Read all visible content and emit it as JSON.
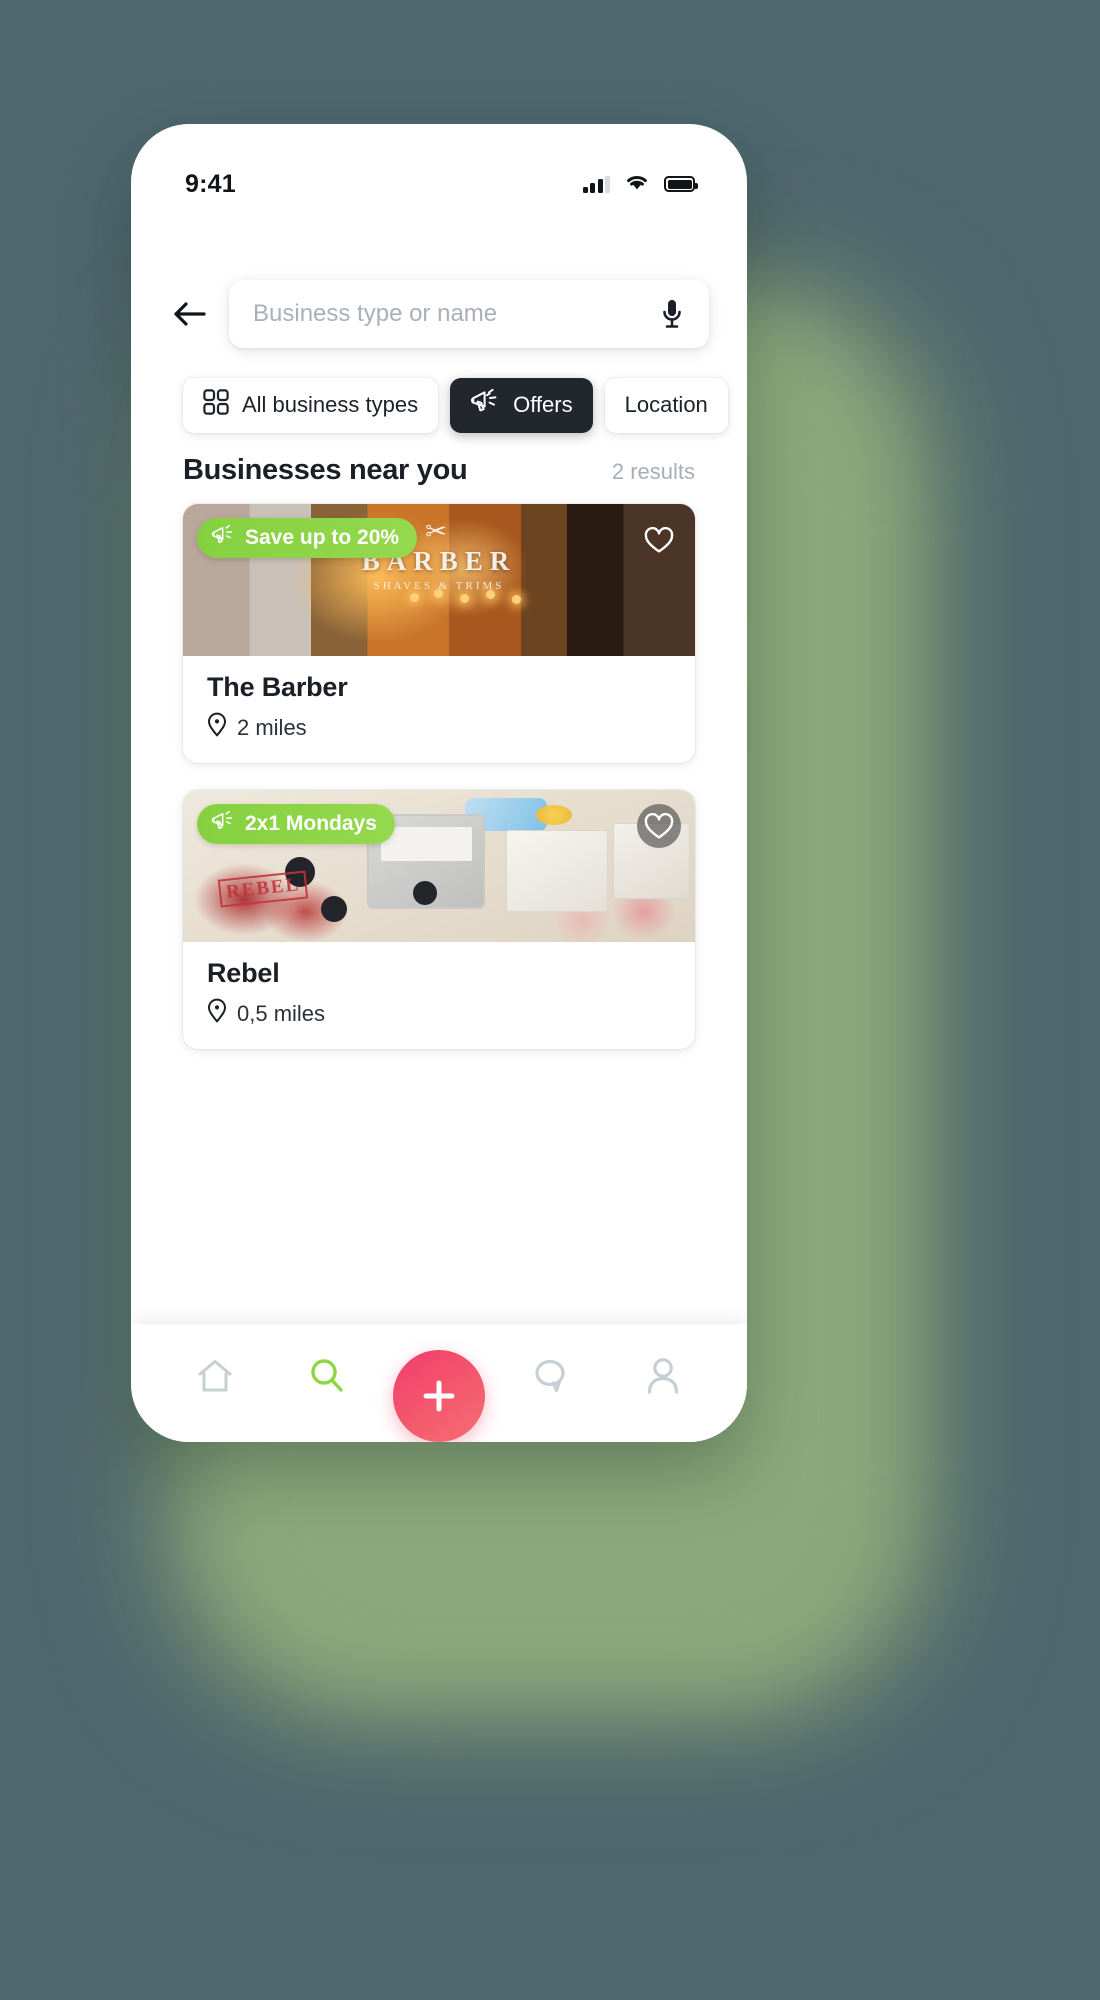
{
  "theme": {
    "background": "#4e676e",
    "glow": "#8aa87c",
    "accent_green": "#8ed444",
    "accent_pink": "#f2426b",
    "chip_active_bg": "#22272e",
    "text_dark": "#1b2026",
    "text_muted": "#a7aeb5"
  },
  "status_bar": {
    "clock": "9:41",
    "signal_icon": "cellular-signal-icon",
    "signal_bars_filled": 3,
    "signal_bars_total": 4,
    "wifi_icon": "wifi-icon",
    "battery_icon": "battery-full-icon"
  },
  "search": {
    "back_icon": "arrow-left-icon",
    "placeholder": "Business type or name",
    "value": "",
    "mic_icon": "microphone-icon"
  },
  "filters": [
    {
      "id": "all-business-types",
      "label": "All business types",
      "icon": "grid-icon",
      "active": false
    },
    {
      "id": "offers",
      "label": "Offers",
      "icon": "megaphone-icon",
      "active": true
    },
    {
      "id": "location",
      "label": "Location",
      "icon": "",
      "active": false
    }
  ],
  "section": {
    "title": "Businesses near you",
    "result_count": "2 results"
  },
  "cards": [
    {
      "name": "The Barber",
      "distance": "2 miles",
      "distance_icon": "location-pin-icon",
      "offer_label": "Save up to 20%",
      "offer_icon": "megaphone-icon",
      "favorite_icon": "heart-outline-icon",
      "favorited": false,
      "photo_alt": "barber-shop-storefront-photo",
      "photo_sign": {
        "scissors": "✂",
        "word": "BARBER",
        "sub": "SHAVES & TRIMS"
      }
    },
    {
      "name": "Rebel",
      "distance": "0,5 miles",
      "distance_icon": "location-pin-icon",
      "offer_label": "2x1 Mondays",
      "offer_icon": "megaphone-icon",
      "favorite_icon": "heart-outline-icon",
      "favorited": false,
      "photo_alt": "packaged-meat-products-photo",
      "photo_stamp": "REBEL"
    }
  ],
  "bottom_nav": {
    "items": [
      {
        "id": "home",
        "icon": "home-icon",
        "active": false
      },
      {
        "id": "search",
        "icon": "search-icon",
        "active": true
      },
      {
        "id": "messages",
        "icon": "chat-bubble-icon",
        "active": false
      },
      {
        "id": "profile",
        "icon": "user-icon",
        "active": false
      }
    ],
    "fab": {
      "id": "create",
      "icon": "plus-icon"
    }
  }
}
